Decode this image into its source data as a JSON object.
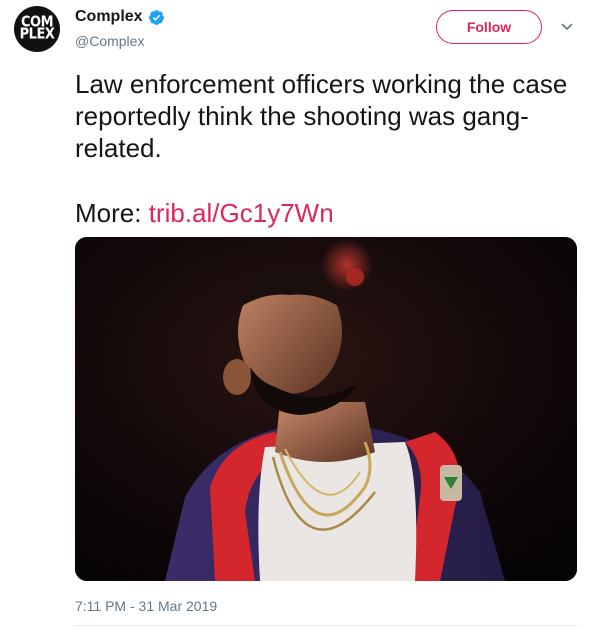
{
  "account": {
    "avatar_line1": "COM",
    "avatar_line2": "PLEX",
    "display_name": "Complex",
    "handle": "@Complex",
    "verified": true
  },
  "actions": {
    "follow_label": "Follow",
    "menu_icon": "chevron-down-icon"
  },
  "tweet": {
    "text": "Law enforcement officers working the case reportedly think the shooting was gang-related.",
    "more_label": "More:",
    "link_text": "trib.al/Gc1y7Wn",
    "timestamp": "7:11 PM - 31 Mar 2019"
  },
  "colors": {
    "accent": "#e0245e",
    "verified_blue": "#1da1f2",
    "muted": "#657786",
    "text": "#14171a"
  }
}
